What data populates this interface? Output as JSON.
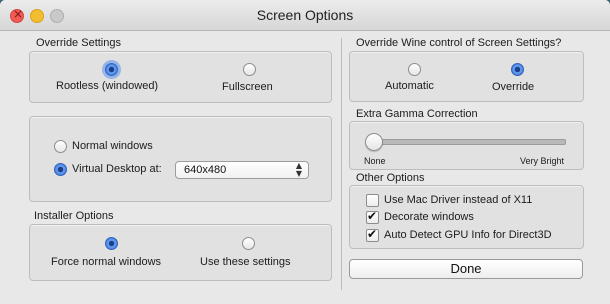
{
  "window": {
    "title": "Screen Options"
  },
  "override_settings": {
    "title": "Override Settings",
    "options": [
      "Rootless (windowed)",
      "Fullscreen"
    ],
    "selected": "Rootless (windowed)"
  },
  "window_mode": {
    "options": [
      "Normal windows",
      "Virtual Desktop at:"
    ],
    "selected": "Virtual Desktop at:",
    "resolution": "640x480"
  },
  "installer_options": {
    "title": "Installer Options",
    "options": [
      "Force normal windows",
      "Use these settings"
    ],
    "selected": "Force normal windows"
  },
  "wine_control": {
    "title": "Override Wine control of Screen Settings?",
    "options": [
      "Automatic",
      "Override"
    ],
    "selected": "Override"
  },
  "gamma": {
    "title": "Extra Gamma Correction",
    "min_label": "None",
    "max_label": "Very Bright",
    "value": 0
  },
  "other_options": {
    "title": "Other Options",
    "items": [
      {
        "label": "Use Mac Driver instead of X11",
        "checked": false
      },
      {
        "label": "Decorate windows",
        "checked": true
      },
      {
        "label": "Auto Detect GPU Info for Direct3D",
        "checked": true
      }
    ]
  },
  "done_button": {
    "label": "Done"
  }
}
